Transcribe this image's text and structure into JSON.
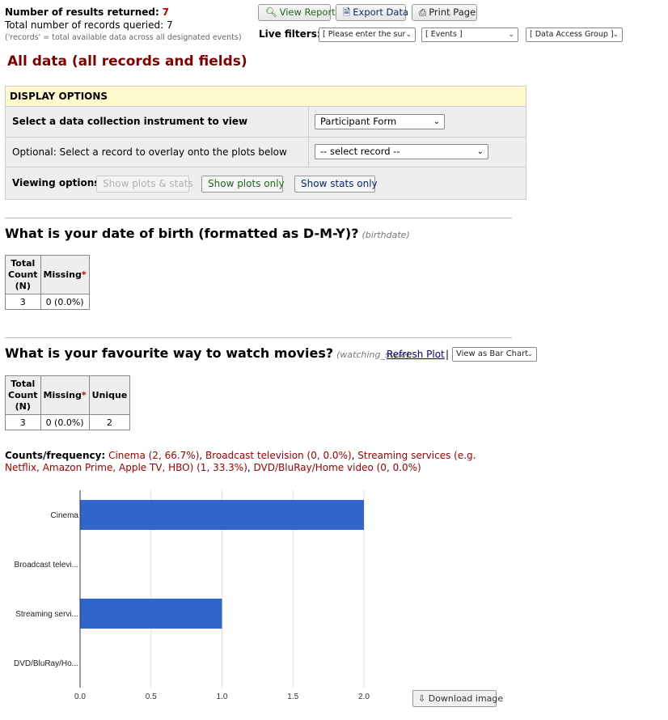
{
  "stats": {
    "results_label": "Number of results returned:",
    "results_value": "7",
    "queried_label": "Total number of records queried:",
    "queried_value": "7",
    "note": "('records' = total available data across all designated events)"
  },
  "toolbar": {
    "view_report": "View Report",
    "export_data": "Export Data",
    "print_page": "Print Page"
  },
  "live_filters": {
    "label": "Live filters:",
    "survey": "[ Please enter the sur",
    "events": "[ Events ]",
    "dag": "[ Data Access Group ]"
  },
  "page_title": "All data (all records and fields)",
  "display_options": {
    "heading": "DISPLAY OPTIONS",
    "instrument_label": "Select a data collection instrument to view",
    "instrument_value": "Participant Form",
    "record_label": "Optional: Select a record to overlay onto the plots below",
    "record_value": "-- select record --",
    "viewing_label": "Viewing options:",
    "btn_plots_stats": "Show plots & stats",
    "btn_plots_only": "Show plots only",
    "btn_stats_only": "Show stats only"
  },
  "q1": {
    "title": "What is your date of birth (formatted as D-M-Y)?",
    "var": "(birthdate)",
    "headers": [
      "Total Count (N)",
      "Missing"
    ],
    "total": "3",
    "missing": "0 (0.0%)"
  },
  "q2": {
    "title": "What is your favourite way to watch movies?",
    "var": "(watching_style)",
    "refresh": "Refresh Plot",
    "pipe": "|",
    "view_as": "View as Bar Chart",
    "headers": [
      "Total Count (N)",
      "Missing",
      "Unique"
    ],
    "total": "3",
    "missing": "0 (0.0%)",
    "unique": "2",
    "counts_label": "Counts/frequency:",
    "counts": [
      "Cinema (2, 66.7%)",
      "Broadcast television (0, 0.0%)",
      "Streaming services (e.g. Netflix, Amazon Prime, Apple TV, HBO) (1, 33.3%)",
      "DVD/BluRay/Home video (0, 0.0%)"
    ]
  },
  "download_image": "Download image",
  "colors": {
    "bar": "#3366cc",
    "title_red": "#800000",
    "accent_red": "#a00000"
  },
  "chart_data": {
    "type": "bar",
    "orientation": "horizontal",
    "categories": [
      "Cinema",
      "Broadcast televi...",
      "Streaming servi...",
      "DVD/BluRay/Ho..."
    ],
    "values": [
      2,
      0,
      1,
      0
    ],
    "xticks": [
      "0.0",
      "0.5",
      "1.0",
      "1.5",
      "2.0"
    ],
    "xlim": [
      0,
      2
    ],
    "grid": true
  }
}
